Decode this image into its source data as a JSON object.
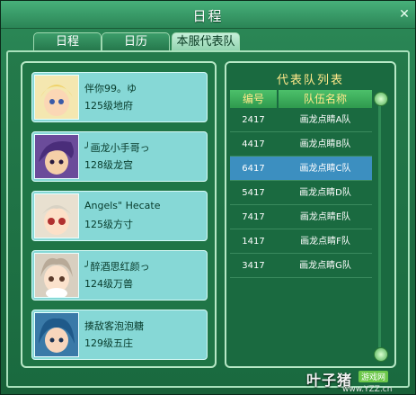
{
  "window": {
    "title": "日程",
    "close_label": "✕"
  },
  "tabs": [
    {
      "label": "日程",
      "active": false
    },
    {
      "label": "日历",
      "active": false
    },
    {
      "label": "本服代表队",
      "active": true
    }
  ],
  "members": [
    {
      "name": "伴你99。ゆ",
      "level": "125级地府"
    },
    {
      "name": "╯画龙小手哥っ",
      "level": "128级龙宫"
    },
    {
      "name": "Angels\" Hecate",
      "level": "125级方寸"
    },
    {
      "name": "╯醉酒思红颜っ",
      "level": "124级万兽"
    },
    {
      "name": "揍敌客泡泡糖",
      "level": "129级五庄"
    }
  ],
  "team_list": {
    "title": "代表队列表",
    "headers": [
      "编号",
      "队伍名称"
    ],
    "rows": [
      {
        "id": "2417",
        "name": "画龙点睛A队",
        "selected": false
      },
      {
        "id": "4417",
        "name": "画龙点睛B队",
        "selected": false
      },
      {
        "id": "6417",
        "name": "画龙点睛C队",
        "selected": true
      },
      {
        "id": "5417",
        "name": "画龙点睛D队",
        "selected": false
      },
      {
        "id": "7417",
        "name": "画龙点睛E队",
        "selected": false
      },
      {
        "id": "1417",
        "name": "画龙点睛F队",
        "selected": false
      },
      {
        "id": "3417",
        "name": "画龙点睛G队",
        "selected": false
      }
    ]
  },
  "watermark": {
    "main": "叶子猪",
    "badge": "游戏网",
    "url": "www.YZZ.cn"
  }
}
